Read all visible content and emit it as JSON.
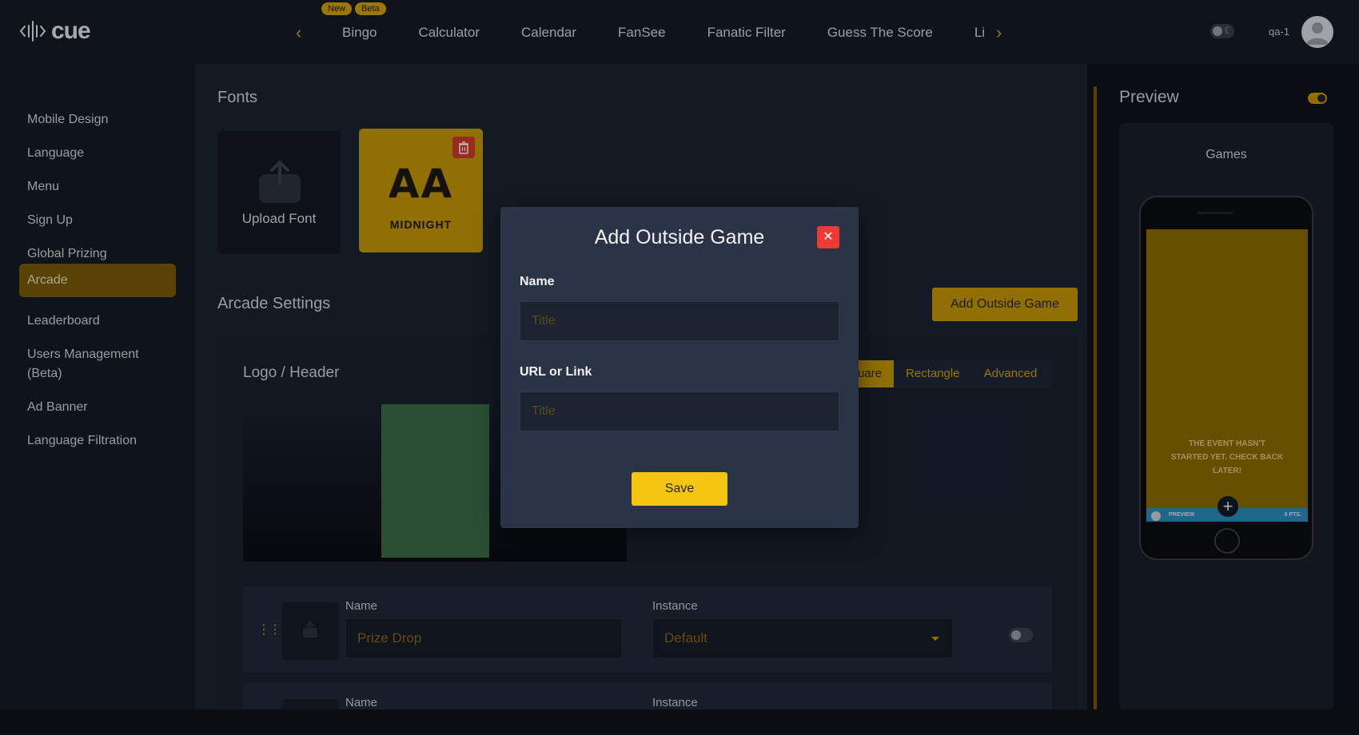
{
  "topbar": {
    "logo_text": "cue",
    "tabs": [
      {
        "label": "Bingo",
        "badges": [
          "New",
          "Beta"
        ]
      },
      {
        "label": "Calculator"
      },
      {
        "label": "Calendar"
      },
      {
        "label": "FanSee"
      },
      {
        "label": "Fanatic Filter"
      },
      {
        "label": "Guess The Score"
      },
      {
        "label": "Lig"
      }
    ],
    "username": "qa-1"
  },
  "sidebar": {
    "items": [
      {
        "label": "Mobile Design"
      },
      {
        "label": "Language"
      },
      {
        "label": "Menu"
      },
      {
        "label": "Sign Up"
      },
      {
        "label": "Global Prizing"
      },
      {
        "label": "Arcade",
        "active": true
      },
      {
        "label": "Leaderboard"
      },
      {
        "label": "Users Management (Beta)"
      },
      {
        "label": "Ad Banner"
      },
      {
        "label": "Language Filtration"
      }
    ]
  },
  "main": {
    "fonts_title": "Fonts",
    "upload_font_label": "Upload Font",
    "font_tile": {
      "sample": "AA",
      "name": "Midnight"
    },
    "arcade_title": "Arcade Settings",
    "add_outside_game_label": "Add Outside Game",
    "logo_header_label": "Logo / Header",
    "shape_options": [
      "uare",
      "Rectangle",
      "Advanced"
    ],
    "rows": [
      {
        "name_label": "Name",
        "name_value": "Prize Drop",
        "instance_label": "Instance",
        "instance_value": "Default"
      },
      {
        "name_label": "Name",
        "instance_label": "Instance"
      }
    ]
  },
  "preview": {
    "title": "Preview",
    "games_label": "Games",
    "phone_message": "The Event Hasn't Started Yet. Check Back Later!",
    "phone_bar_left": "Preview",
    "phone_bar_right": "0 pts."
  },
  "modal": {
    "title": "Add Outside Game",
    "name_label": "Name",
    "name_placeholder": "Title",
    "url_label": "URL or Link",
    "url_placeholder": "Title",
    "save_label": "Save"
  },
  "colors": {
    "accent": "#c89a08",
    "accent_bright": "#f3c613",
    "danger": "#ee3a34",
    "background": "#1d2431",
    "modal_background": "#2a3446"
  },
  "icons": {
    "logo": "audio-wave-icon",
    "upload": "upload-arrow-icon",
    "delete": "trash-icon",
    "close": "close-icon",
    "theme": "moon-icon",
    "drag": "drag-handle-icon"
  }
}
